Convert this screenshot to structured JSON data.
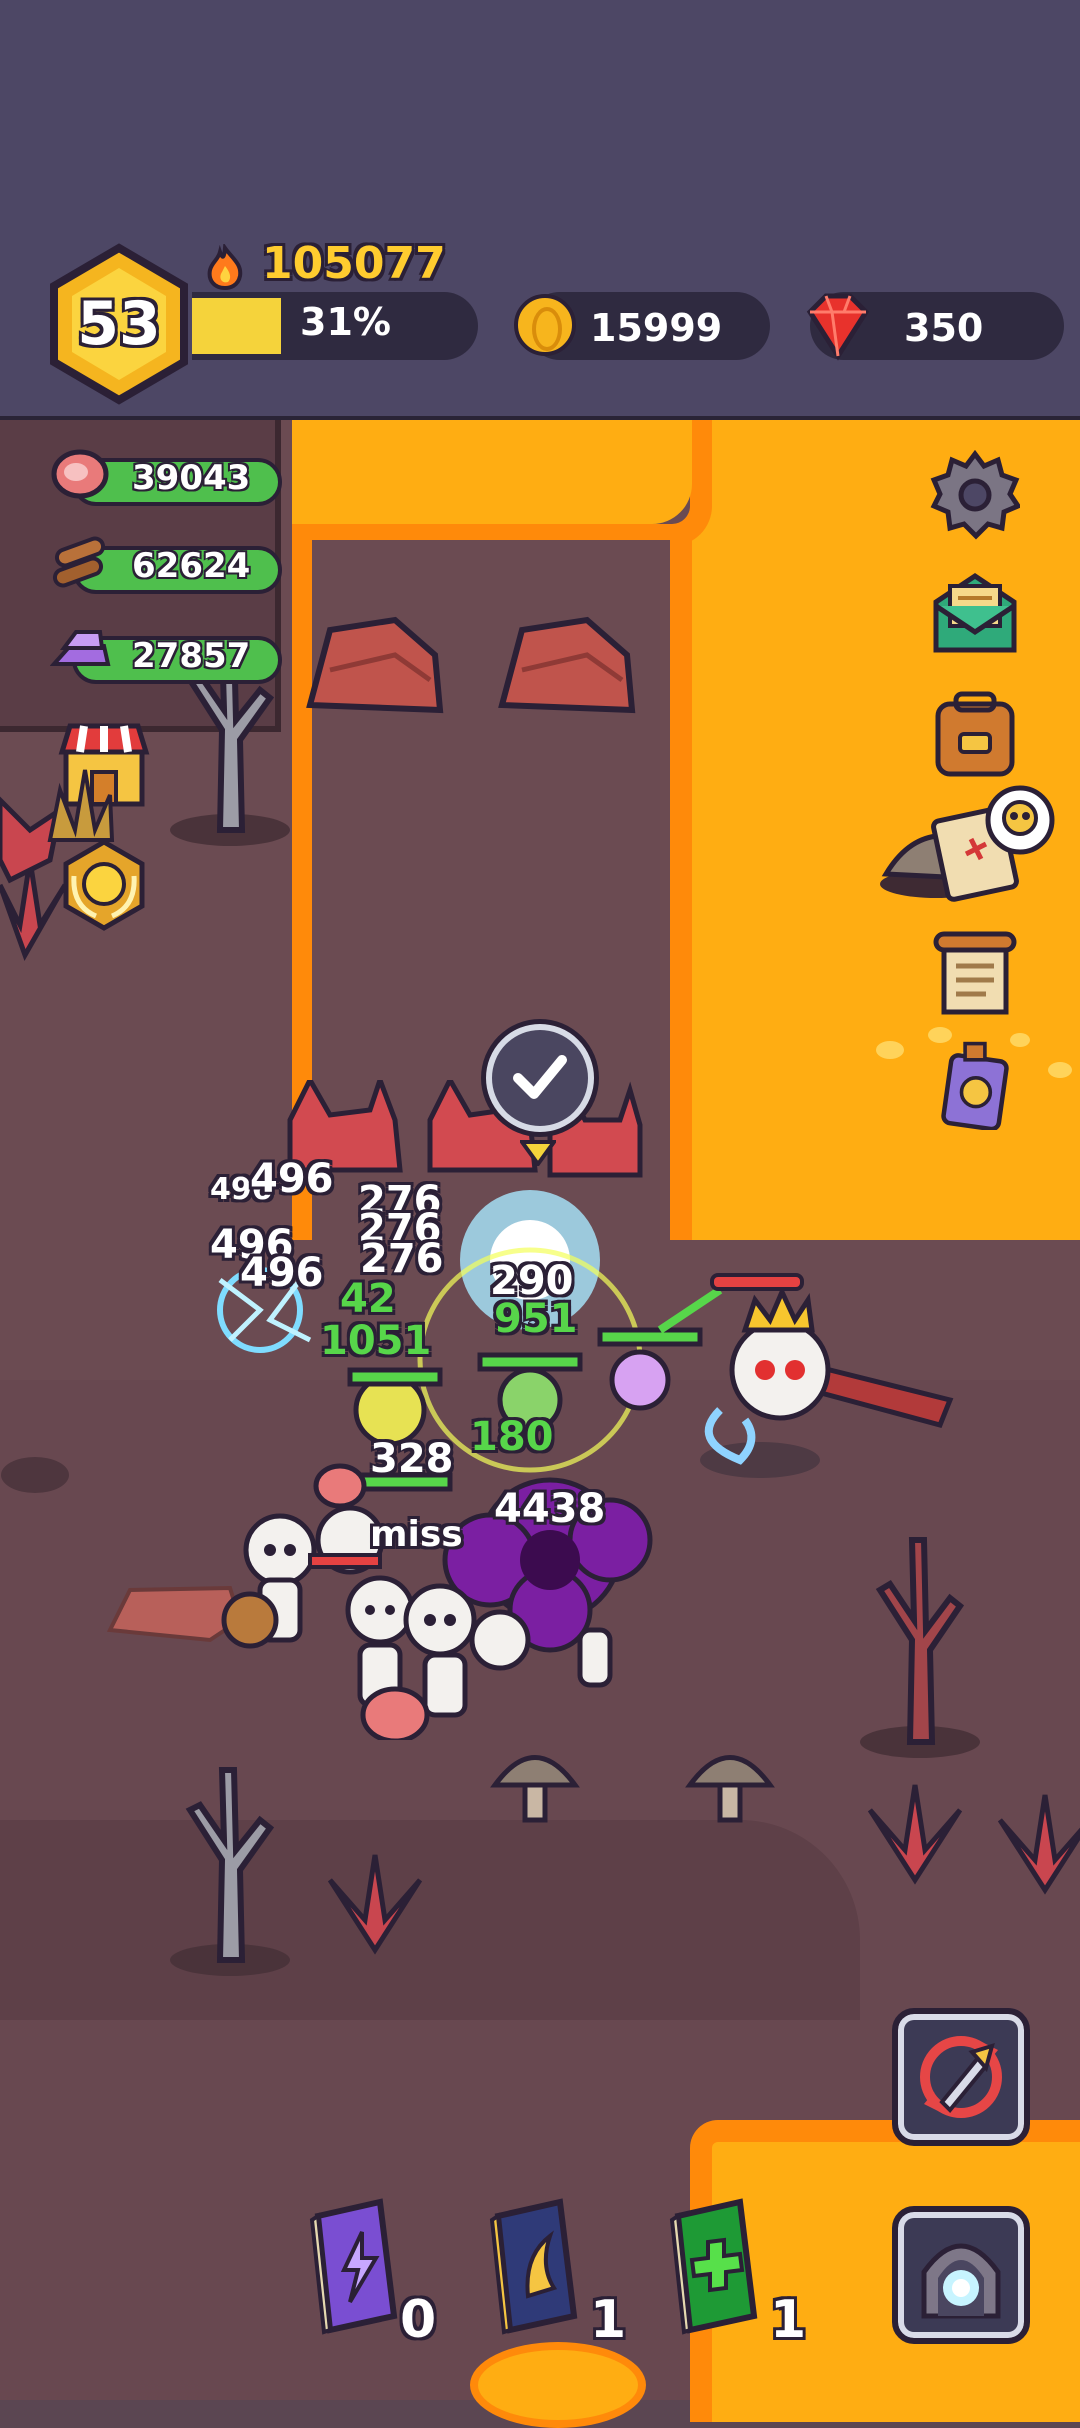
{
  "hud": {
    "level": "53",
    "power": "105077",
    "xp_percent_label": "31%",
    "xp_fraction": 0.31,
    "gold": "15999",
    "gems": "350"
  },
  "resources": {
    "meat": "39043",
    "wood": "62624",
    "crystal": "27857"
  },
  "damage_numbers": [
    "496",
    "496",
    "496",
    "496",
    "276",
    "276",
    "276",
    "42",
    "1051",
    "290",
    "951",
    "180",
    "328",
    "miss",
    "4438"
  ],
  "skill_books": {
    "lightning_count": "0",
    "wind_count": "1",
    "heal_count": "1"
  },
  "icons": {
    "settings": "gear-icon",
    "mail": "mail-icon",
    "bag": "backpack-icon",
    "treasure_map": "treasure-map-icon",
    "quest": "scroll-icon",
    "card": "card-icon",
    "shop": "shop-icon",
    "achievement": "laurel-badge-icon",
    "auto_battle": "auto-battle-icon",
    "portal": "portal-icon",
    "target_confirm": "checkmark-icon"
  },
  "colors": {
    "lava": "#ffad12",
    "gold_text": "#ffcc2f",
    "resource_green": "#4fbf4d",
    "topbar": "#4d4765"
  }
}
